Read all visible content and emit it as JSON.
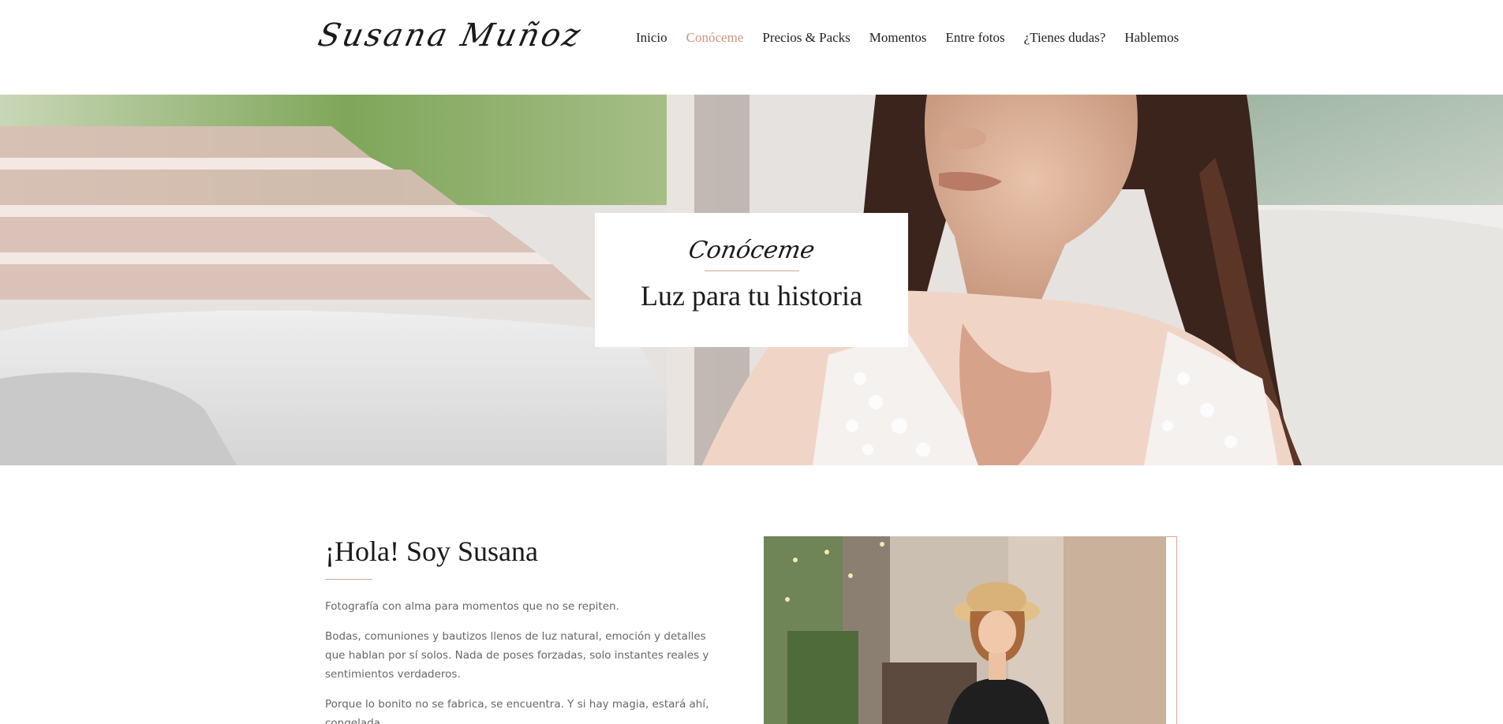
{
  "brand": {
    "logo_text": "Susana Muñoz"
  },
  "nav": {
    "items": [
      {
        "label": "Inicio",
        "active": false
      },
      {
        "label": "Conóceme",
        "active": true
      },
      {
        "label": "Precios & Packs",
        "active": false
      },
      {
        "label": "Momentos",
        "active": false
      },
      {
        "label": "Entre fotos",
        "active": false
      },
      {
        "label": "¿Tienes dudas?",
        "active": false
      },
      {
        "label": "Hablemos",
        "active": false
      }
    ]
  },
  "hero": {
    "script_label": "Conóceme",
    "title": "Luz para tu historia"
  },
  "about": {
    "heading": "¡Hola! Soy Susana",
    "paragraphs": [
      "Fotografía con alma para momentos que no se repiten.",
      "Bodas, comuniones y bautizos llenos de luz natural, emoción y detalles que hablan por sí solos. Nada de poses forzadas, solo instantes reales y sentimientos verdaderos.",
      "Porque lo bonito no se fabrica, se encuentra. Y si hay magia, estará ahí, congelada"
    ]
  },
  "colors": {
    "accent": "#c99680",
    "rule": "#d8a592",
    "text": "#1a1a1a",
    "body_text": "#666666"
  }
}
